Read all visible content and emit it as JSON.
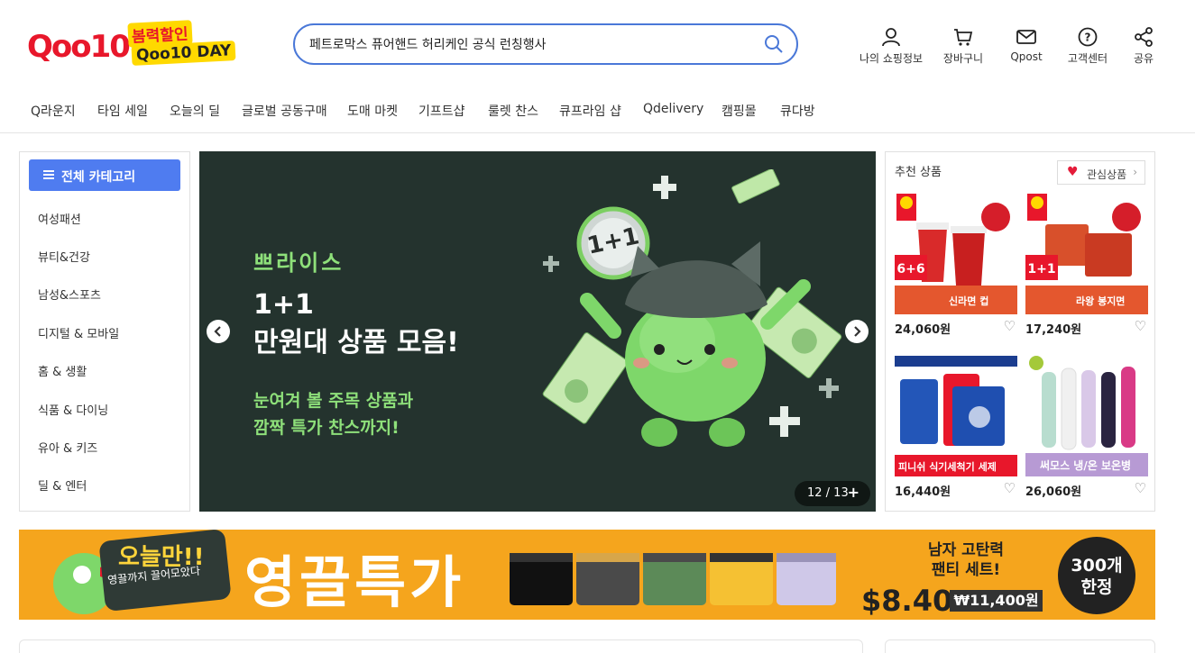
{
  "logo": {
    "brand": "Qoo10",
    "badge_top": "봄력할인",
    "badge_bottom": "Qoo10 DAY"
  },
  "search": {
    "value": "페트로막스 퓨어핸드 허리케인 공식 런칭행사"
  },
  "top_icons": [
    {
      "label": "나의 쇼핑정보",
      "icon": "user-icon"
    },
    {
      "label": "장바구니",
      "icon": "cart-icon"
    },
    {
      "label": "Qpost",
      "icon": "mail-icon"
    },
    {
      "label": "고객센터",
      "icon": "help-icon"
    },
    {
      "label": "공유",
      "icon": "share-icon"
    }
  ],
  "nav": [
    "Q라운지",
    "타임 세일",
    "오늘의 딜",
    "글로벌 공동구매",
    "도매 마켓",
    "기프트샵",
    "룰렛 찬스",
    "큐프라임 샵",
    "Qdelivery",
    "캠핑몰",
    "큐다방"
  ],
  "sidebar": {
    "button_label": "전체 카테고리",
    "items": [
      "여성패션",
      "뷰티&건강",
      "남성&스포츠",
      "디지털 & 모바일",
      "홈 & 생활",
      "식품 & 다이닝",
      "유아 & 키즈",
      "딜 & 엔터"
    ]
  },
  "banner": {
    "brand": "쁘라이스",
    "headline_1": "1+1",
    "headline_2": "만원대 상품 모음!",
    "sub_1": "눈여겨 볼 주목 상품과",
    "sub_2": "깜짝 특가 찬스까지!",
    "coin_text": "1+1",
    "counter": "12 / 13",
    "counter_plus": "+"
  },
  "recommended": {
    "title": "추천 상품",
    "wish_label": "관심상품",
    "products": [
      {
        "price": "24,060원",
        "label": "신라면 컵",
        "tag": "6+6"
      },
      {
        "price": "17,240원",
        "label": "라왕 봉지면",
        "tag": "1+1"
      },
      {
        "price": "16,440원",
        "label": "피니쉬 식기세척기 세제"
      },
      {
        "price": "26,060원",
        "label": "써모스 냉/온 보온병"
      }
    ]
  },
  "promo": {
    "badge": "오늘만!!",
    "badge_sub": "영끌까지 끌어모았다",
    "title": "영끌특가",
    "desc_1": "남자 고탄력",
    "desc_2": "팬티 세트!",
    "price": "$8.40",
    "original_price": "₩11,400원",
    "limit_1": "300개",
    "limit_2": "한정"
  },
  "colors": {
    "accent": "#4f7cf0",
    "brand": "#e8172b",
    "banner_bg": "#24332e",
    "promo_bg": "#f5a51d"
  }
}
